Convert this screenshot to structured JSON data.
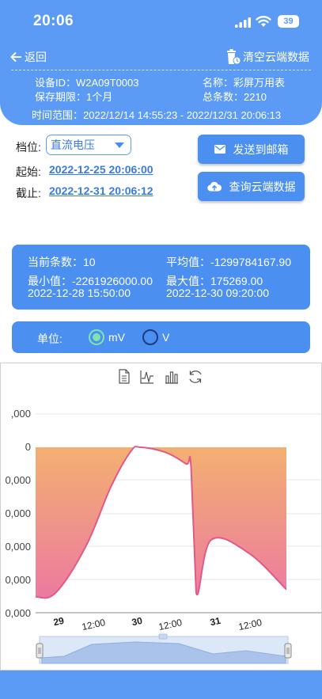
{
  "status": {
    "time": "20:06",
    "battery": "39"
  },
  "nav": {
    "back_label": "返回",
    "clear_label": "清空云端数据"
  },
  "device": {
    "id_label": "设备ID：W2A09T0003",
    "name_label": "名称：彩屏万用表",
    "retention_label": "保存期限：1个月",
    "total_label": "总条数：2210",
    "range_label": "时间范围：2022/12/14 14:55:23 - 2022/12/31 20:06:13"
  },
  "controls": {
    "gear_label": "档位:",
    "gear_value": "直流电压",
    "start_label": "起始:",
    "start_value": "2022-12-25 20:06:00",
    "end_label": "截止:",
    "end_value": "2022-12-31 20:06:12",
    "send_email_label": "发送到邮箱",
    "query_label": "查询云端数据"
  },
  "stats": {
    "count_label": "当前条数：10",
    "avg_label": "平均值：-1299784167.90",
    "min_label": "最小值：-2261926000.00",
    "min_time": "2022-12-28 15:50:00",
    "max_label": "最大值：175269.00",
    "max_time": "2022-12-30 09:20:00"
  },
  "unit": {
    "label": "单位:",
    "options": [
      "mV",
      "V"
    ],
    "selected": "mV"
  },
  "toolbar_icons": [
    "data-view-icon",
    "line-chart-icon",
    "bar-chart-icon",
    "restore-icon"
  ],
  "colors": {
    "primary": "#5b9bf5",
    "button": "#4b8ff0",
    "link": "#3a7be0",
    "line": "#e05a88",
    "area_top": "#f3b071",
    "area_bottom": "#ec7aa0"
  },
  "chart_data": {
    "type": "area",
    "y_tick_labels": [
      ",000",
      "0",
      "0,000",
      "0,000",
      "0,000",
      "0,000",
      "0,000"
    ],
    "x_tick_labels": [
      {
        "text": "29",
        "bold": true
      },
      {
        "text": "12:00",
        "bold": false
      },
      {
        "text": "30",
        "bold": true
      },
      {
        "text": "12:00",
        "bold": false
      },
      {
        "text": "31",
        "bold": true
      },
      {
        "text": "12:00",
        "bold": false
      }
    ],
    "ylim": [
      -2261926000,
      175269
    ],
    "series": [
      {
        "points": [
          {
            "x": 0.0,
            "y": -2261926000
          },
          {
            "x": 0.08,
            "y": -2200000000
          },
          {
            "x": 0.2,
            "y": -1500000000
          },
          {
            "x": 0.3,
            "y": -600000000
          },
          {
            "x": 0.38,
            "y": -60000000
          },
          {
            "x": 0.42,
            "y": 0
          },
          {
            "x": 0.52,
            "y": -80000000
          },
          {
            "x": 0.6,
            "y": -250000000
          },
          {
            "x": 0.62,
            "y": -300000000
          },
          {
            "x": 0.64,
            "y": -2200000000
          },
          {
            "x": 0.7,
            "y": -1400000000
          },
          {
            "x": 0.85,
            "y": -1600000000
          },
          {
            "x": 1.0,
            "y": -2150000000
          }
        ]
      }
    ],
    "grid": true,
    "zoom_slider": true
  }
}
